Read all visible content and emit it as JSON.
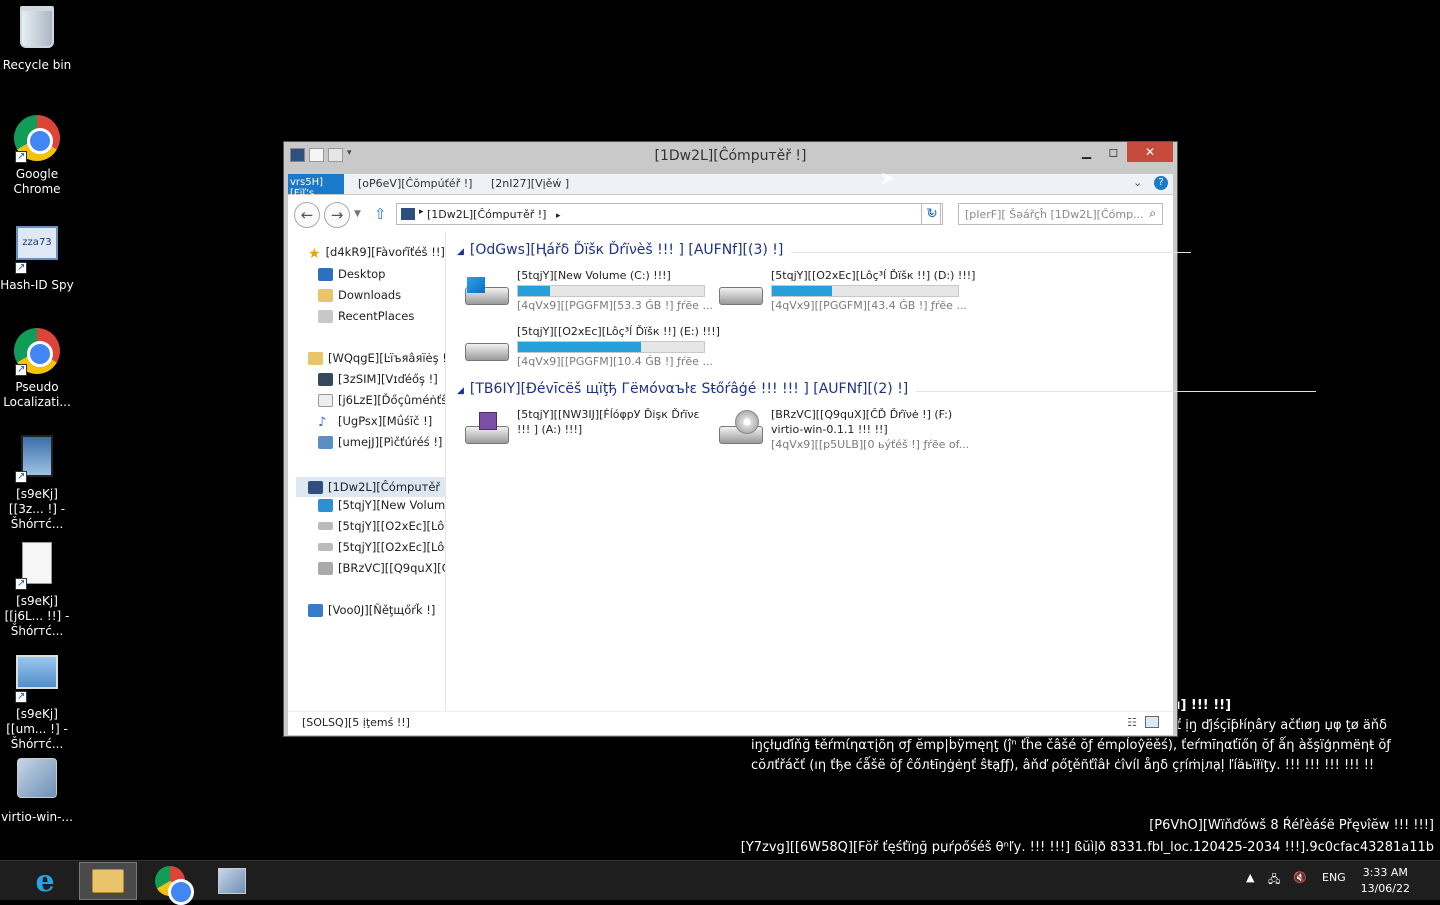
{
  "desktop": {
    "icons": [
      {
        "label": "Recycle bin"
      },
      {
        "label": "Google Chrome"
      },
      {
        "label": "Hash-ID Spy"
      },
      {
        "label": "Pseudo Localizati..."
      },
      {
        "label": "[s9eKj][[3z... !] - Šhórтć..."
      },
      {
        "label": "[s9eKj][[j6L... !!] - Šhórтć..."
      },
      {
        "label": "[s9eKj][[um... !] - Šhórтć..."
      },
      {
        "label": "virtio-win-..."
      }
    ],
    "hash_id_badge": "zza73"
  },
  "window": {
    "title": "[1Dw2L][Ĉómpuтěř !]",
    "ribbon": {
      "file": "vrs5H][Fïľ's",
      "computer": "[oP6eV][Ĉŏmpúťéř !]",
      "view": "[2nI27][Vįěẃ ]"
    },
    "address": {
      "path": "[1Dw2L][Ĉómpuтěř !]"
    },
    "search_placeholder": "[pIerF][ Šəářçĥ [1Dw2L][Ĉómp...",
    "nav": {
      "favorites": "[d4kR9][Fàvoŕĭťéš !!]",
      "desktop": "Desktop",
      "downloads": "Downloads",
      "recent": "RecentPlaces",
      "libraries": "[WQqgE][Ŀïъяâяïėş !!]",
      "videos": "[3zSIM][Vɪďéőş !]",
      "documents": "[j6LzE][Ďőçûméṅťŝ !",
      "music": "[UgPsx][Mǘśĭč !]",
      "pictures": "[umejJ][Pìčťúṙéś !]",
      "computer": "[1Dw2L][Ĉómpuтěř !]",
      "c_drive": "[5tqjY][New Volume",
      "d_drive": "[5tqjY][[O2xEc][Lôç³",
      "e_drive": "[5tqjY][[O2xEc][Lôç³",
      "f_drive": "[BRzVC][[Q9quX][ĈĎ",
      "network": "[Voo0J][Ñěţщőŕǩ !]"
    },
    "groups": {
      "hard_disks": "[OdGws][Ңářδ Ďïšк Ďŕïνèš !!! ] [AUFNf][(3) !]",
      "removable": "[TB6IY][Ðévīcëš щïţђ Гёмόναъŀε Sŧőŕâģé !!! !!! ] [AUFNf][(2) !]"
    },
    "drives": [
      {
        "name": "[5tqjY][New Volume (C:) !!!]",
        "free": "[4qVx9][[PGGFM][53.3 ĠB !] ƒŕẽе ...",
        "used": 0.17
      },
      {
        "name": "[5tqjY][[O2xEc][Lôç³ĺ Ďïšк !!] (D:) !!!]",
        "free": "[4qVx9][[PGGFM][43.4 ĠB !] ƒŕẽе ...",
        "used": 0.32
      },
      {
        "name": "[5tqjY][[O2xEc][Lôç³ĺ Ďïšк !!] (E:) !!!]",
        "free": "[4qVx9][[PGGFM][10.4 ĠB !] ƒŕẽе ...",
        "used": 0.66
      }
    ],
    "removable": [
      {
        "name1": "[5tqjY][[NW3IJ][ḞĺóφрУ Ďişк Ďŕїνε",
        "name2": "!!! ] (A:) !!!]"
      },
      {
        "name1": "[BRzVC][[Q9quX][ĈĎ Ďŕïνė !] (F:)",
        "name2": "virtio-win-0.1.1 !!! !!]",
        "free": "[4qVx9][[p5ULB][0 ьýťéš !] ƒŕẽе оf..."
      }
    ],
    "status": "[SOLSQ][5 ịţеmś !!]"
  },
  "watermark": {
    "line0": "ı] !!! !!]",
    "line1": "ť ịŋ ďjśçĭƥŀíņâry ačťıøŋ џφ ţø äňδ",
    "line2": "іŋçłџďíňğ ŧěŕmίηατįõη σƒ ĕmp|ḃÿmęηţ (ĵⁿ ťĥe čâšé ŏƒ émρĺοŷёěś), ťeŕmīηαťĭőη ŏƒ ǻη àšşïģņmëηŧ ŏƒ",
    "line3": "сŏлťřáčť (ıη ťђе ćǻšё ŏƒ ĉőлŧīŋġėŋť ŝŧạƒƒ), âňď ρőţěñťîâŀ ċîvíl åŋδ çŗíṁįлạļ ľíäьïłïţу. !!! !!! !!! !!! !!",
    "line4": "[P6VhO][Wïňďówš 8 Ŕéľèáśë Přęνîĕw !!! !!!]",
    "line5": "[Y7zvg][[6W58Q][Fŏř ťęśťïŋğ pџŕρőśéš θⁿľу. !!! !!!] ßŭìļð 8331.fbl_loc.120425-2034 !!!].9c0cfac43281a11b"
  },
  "taskbar": {
    "lang": "ENG",
    "time": "3:33 AM",
    "date": "13/06/22"
  }
}
